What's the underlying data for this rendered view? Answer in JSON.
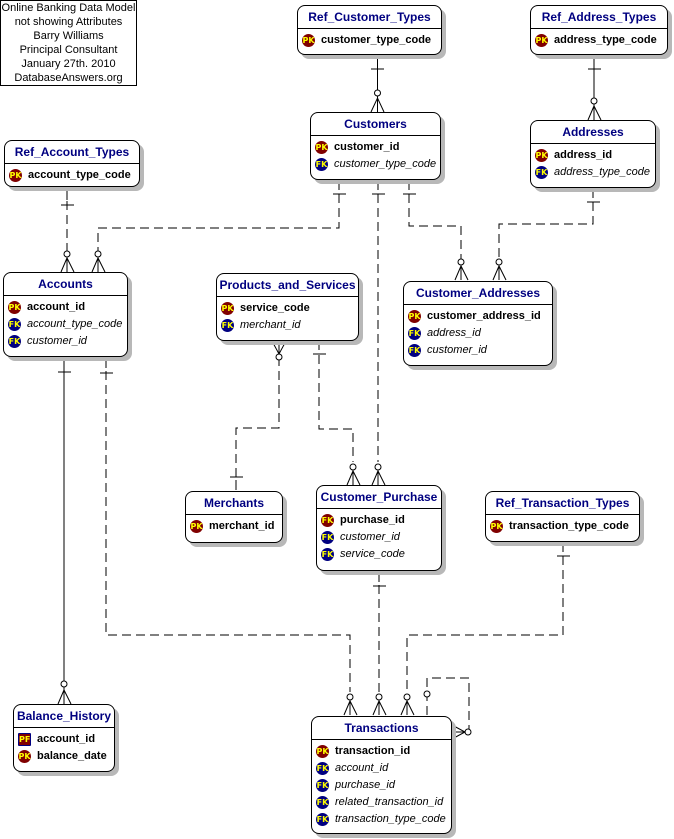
{
  "note": {
    "lines": [
      "Online Banking Data Model",
      "not showing Attributes",
      "Barry Williams",
      "Principal Consultant",
      "January 27th. 2010",
      "DatabaseAnswers.org"
    ]
  },
  "entities": {
    "ref_customer_types": {
      "title": "Ref_Customer_Types",
      "attrs": [
        {
          "key": "PK",
          "name": "customer_type_code"
        }
      ]
    },
    "ref_address_types": {
      "title": "Ref_Address_Types",
      "attrs": [
        {
          "key": "PK",
          "name": "address_type_code"
        }
      ]
    },
    "customers": {
      "title": "Customers",
      "attrs": [
        {
          "key": "PK",
          "name": "customer_id"
        },
        {
          "key": "FK",
          "name": "customer_type_code"
        }
      ]
    },
    "addresses": {
      "title": "Addresses",
      "attrs": [
        {
          "key": "PK",
          "name": "address_id"
        },
        {
          "key": "FK",
          "name": "address_type_code"
        }
      ]
    },
    "ref_account_types": {
      "title": "Ref_Account_Types",
      "attrs": [
        {
          "key": "PK",
          "name": "account_type_code"
        }
      ]
    },
    "accounts": {
      "title": "Accounts",
      "attrs": [
        {
          "key": "PK",
          "name": "account_id"
        },
        {
          "key": "FK",
          "name": "account_type_code"
        },
        {
          "key": "FK",
          "name": "customer_id"
        }
      ]
    },
    "products_and_services": {
      "title": "Products_and_Services",
      "attrs": [
        {
          "key": "PK",
          "name": "service_code"
        },
        {
          "key": "FK",
          "name": "merchant_id"
        }
      ]
    },
    "customer_addresses": {
      "title": "Customer_Addresses",
      "attrs": [
        {
          "key": "PK",
          "name": "customer_address_id"
        },
        {
          "key": "FK",
          "name": "address_id"
        },
        {
          "key": "FK",
          "name": "customer_id"
        }
      ]
    },
    "merchants": {
      "title": "Merchants",
      "attrs": [
        {
          "key": "PK",
          "name": "merchant_id"
        }
      ]
    },
    "customer_purchase": {
      "title": "Customer_Purchase",
      "attrs": [
        {
          "key": "FK",
          "name": "purchase_id"
        },
        {
          "key": "FK",
          "name": "customer_id"
        },
        {
          "key": "FK",
          "name": "service_code"
        }
      ]
    },
    "ref_transaction_types": {
      "title": "Ref_Transaction_Types",
      "attrs": [
        {
          "key": "PK",
          "name": "transaction_type_code"
        }
      ]
    },
    "balance_history": {
      "title": "Balance_History",
      "attrs": [
        {
          "key": "PF",
          "name": "account_id"
        },
        {
          "key": "PK",
          "name": "balance_date"
        }
      ]
    },
    "transactions": {
      "title": "Transactions",
      "attrs": [
        {
          "key": "PK",
          "name": "transaction_id"
        },
        {
          "key": "FK",
          "name": "account_id"
        },
        {
          "key": "FK",
          "name": "purchase_id"
        },
        {
          "key": "FK",
          "name": "related_transaction_id"
        },
        {
          "key": "FK",
          "name": "transaction_type_code"
        }
      ]
    }
  },
  "relationships": [
    {
      "from": "Ref_Customer_Types",
      "to": "Customers",
      "identifying": true
    },
    {
      "from": "Ref_Address_Types",
      "to": "Addresses",
      "identifying": true
    },
    {
      "from": "Ref_Account_Types",
      "to": "Accounts",
      "identifying": false
    },
    {
      "from": "Customers",
      "to": "Accounts",
      "identifying": false
    },
    {
      "from": "Customers",
      "to": "Customer_Addresses",
      "identifying": false
    },
    {
      "from": "Addresses",
      "to": "Customer_Addresses",
      "identifying": false
    },
    {
      "from": "Customers",
      "to": "Customer_Purchase",
      "identifying": false
    },
    {
      "from": "Merchants",
      "to": "Products_and_Services",
      "identifying": false
    },
    {
      "from": "Products_and_Services",
      "to": "Customer_Purchase",
      "identifying": false
    },
    {
      "from": "Accounts",
      "to": "Balance_History",
      "identifying": true
    },
    {
      "from": "Accounts",
      "to": "Transactions",
      "identifying": false
    },
    {
      "from": "Customer_Purchase",
      "to": "Transactions",
      "identifying": false
    },
    {
      "from": "Ref_Transaction_Types",
      "to": "Transactions",
      "identifying": false
    },
    {
      "from": "Transactions",
      "to": "Transactions",
      "identifying": false
    }
  ]
}
